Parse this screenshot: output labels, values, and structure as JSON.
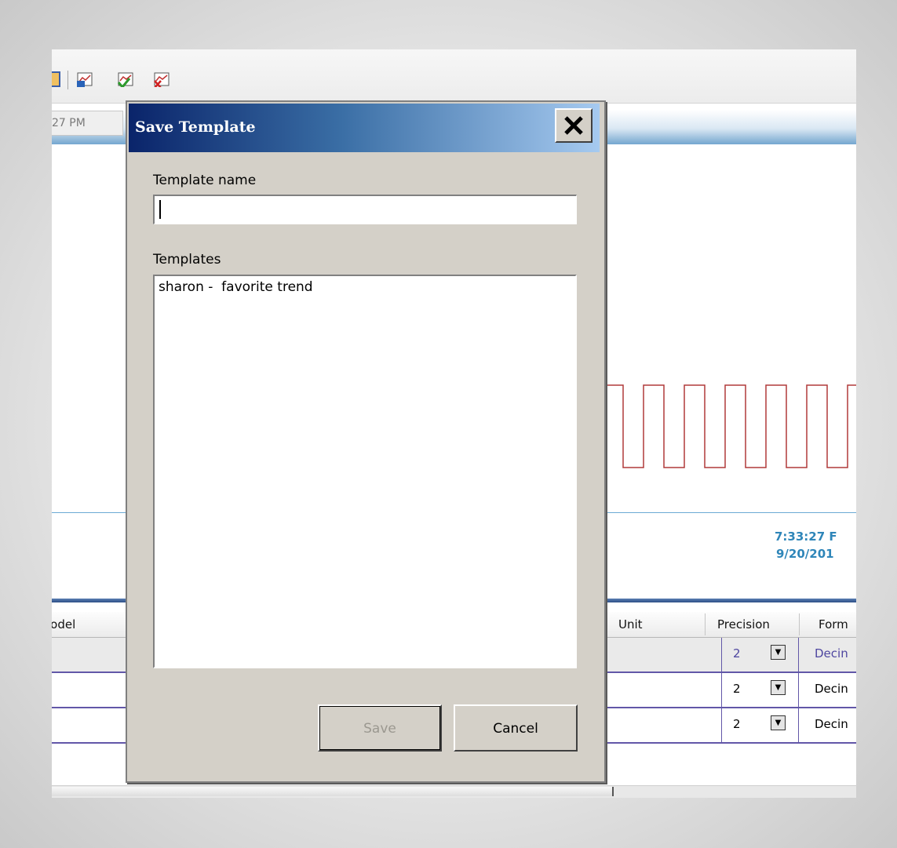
{
  "toolbar": {
    "icons": [
      "open-icon",
      "chart-props-icon",
      "chart-check-icon",
      "chart-delete-icon"
    ],
    "time_value": "27 PM"
  },
  "chart": {
    "time_label": "7:33:27 F",
    "date_label": "9/20/201",
    "series_color": "#b03a3a",
    "baseline_color": "#3c8dc5"
  },
  "grid": {
    "columns": {
      "model": "lodel",
      "unit": "Unit",
      "precision": "Precision",
      "format": "Form"
    },
    "rows": [
      {
        "precision": "2",
        "format": "Decin",
        "selected": true
      },
      {
        "precision": "2",
        "format": "Decin",
        "selected": false
      },
      {
        "precision": "2",
        "format": "Decin",
        "selected": false
      }
    ]
  },
  "dialog": {
    "title": "Save Template",
    "template_name_label": "Template name",
    "template_name_value": "",
    "templates_label": "Templates",
    "templates": [
      "sharon -  favorite trend"
    ],
    "save_label": "Save",
    "cancel_label": "Cancel",
    "save_enabled": false
  }
}
